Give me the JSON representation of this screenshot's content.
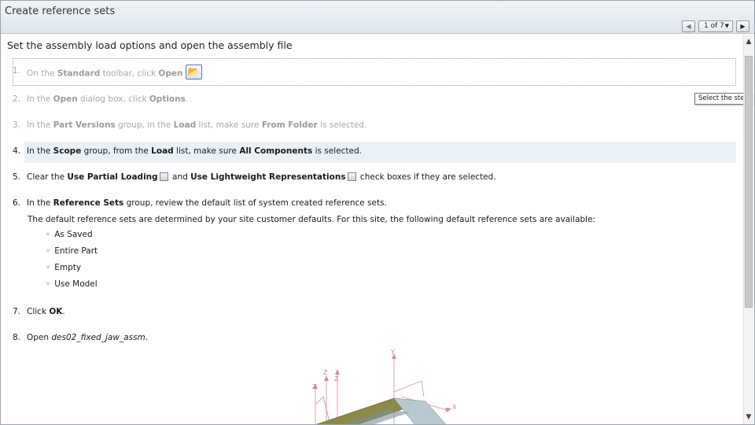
{
  "window": {
    "title": "Create reference sets"
  },
  "pager": {
    "prev_icon": "triangle-left-icon",
    "page": "1 of 7",
    "next_icon": "triangle-right-icon"
  },
  "tooltip": "Select the step",
  "heading": "Set the assembly load options and open the assembly file",
  "steps": [
    {
      "num": "1.",
      "parts": [
        "On the ",
        "Standard",
        " toolbar, click ",
        "Open"
      ]
    },
    {
      "num": "2.",
      "parts": [
        "In the ",
        "Open",
        " dialog box, click ",
        "Options",
        "."
      ]
    },
    {
      "num": "3.",
      "parts": [
        "In the ",
        "Part Versions",
        " group, in the ",
        "Load",
        " list, make sure ",
        "From Folder",
        " is selected."
      ]
    },
    {
      "num": "4.",
      "parts": [
        "In the ",
        "Scope",
        " group, from the ",
        "Load",
        " list, make sure ",
        "All Components",
        " is selected."
      ]
    },
    {
      "num": "5.",
      "parts": [
        "Clear the ",
        "Use Partial Loading",
        " and ",
        "Use Lightweight Representations",
        " check boxes if they are selected."
      ]
    },
    {
      "num": "6.",
      "parts": [
        "In the ",
        "Reference Sets",
        " group, review the default list of system created reference sets."
      ],
      "note": "The default reference sets are determined by your site customer defaults. For this site, the following default reference sets are available:",
      "bullets": [
        "As Saved",
        "Entire Part",
        "Empty",
        "Use Model"
      ]
    },
    {
      "num": "7.",
      "parts": [
        "Click ",
        "OK",
        "."
      ]
    },
    {
      "num": "8.",
      "parts": [
        "Open ",
        "des02_fixed_jaw_assm",
        "."
      ]
    }
  ],
  "model_axes": [
    "Y",
    "Z",
    "Y",
    "Z",
    "X"
  ]
}
